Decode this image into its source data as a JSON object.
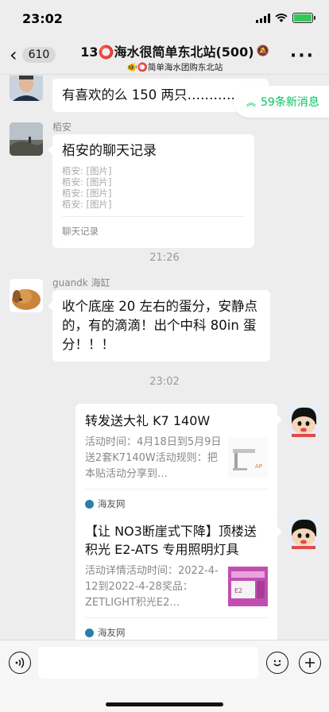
{
  "status_bar": {
    "time": "23:02"
  },
  "nav": {
    "unread_count": "610",
    "title": "13⭕海水很简单东北站(500)",
    "subtitle": "🐠⭕简单海水团购东北站"
  },
  "new_messages_pill": "59条新消息",
  "messages": {
    "m1": {
      "text": "有喜欢的么 150 两只…………自"
    },
    "m2": {
      "sender": "栢安",
      "record_title": "栢安的聊天记录",
      "record_lines": [
        "栢安: [图片]",
        "栢安: [图片]",
        "栢安: [图片]",
        "栢安: [图片]"
      ],
      "record_foot": "聊天记录"
    },
    "time1": "21:26",
    "m3": {
      "sender": "guandk 海缸",
      "text": "收个底座 20 左右的蛋分，安静点的，有的滴滴！出个中科 80in 蛋分！！！"
    },
    "time2": "23:02",
    "m4": {
      "title": "转发送大礼 K7 140W",
      "desc": "活动时间：4月18日到5月9日送2套K7140W活动规则：把本贴活动分享到…",
      "source": "海友网"
    },
    "m5": {
      "title": "【让 NO3断崖式下降】顶楼送积光 E2-ATS 专用照明灯具",
      "desc": "活动详情活动时间：2022-4-12到2022-4-28奖品：ZETLIGHT积光E2…",
      "source": "海友网"
    }
  },
  "input": {
    "placeholder": ""
  },
  "colors": {
    "accent_green": "#07c160",
    "bubble": "#ffffff",
    "background": "#ededed"
  }
}
